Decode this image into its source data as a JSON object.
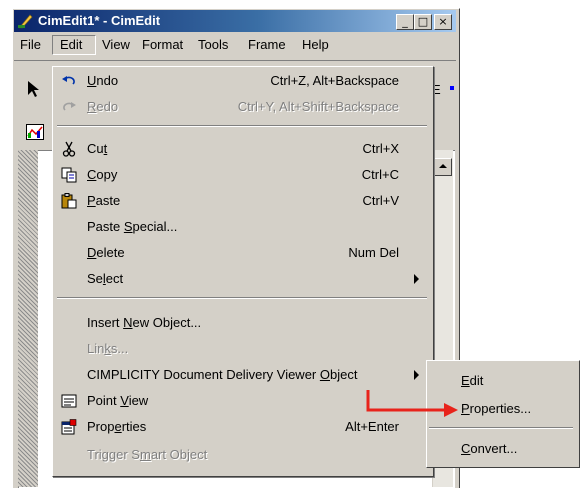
{
  "window": {
    "title": "CimEdit1* - CimEdit",
    "min_label": "_",
    "max_label": "□",
    "close_label": "×"
  },
  "menubar": {
    "items": [
      "File",
      "Edit",
      "View",
      "Format",
      "Tools",
      "Frame",
      "Help"
    ]
  },
  "background": {
    "hint_e": "E"
  },
  "edit_menu": {
    "items": [
      {
        "pre": "",
        "u": "U",
        "post": "ndo",
        "shortcut": "Ctrl+Z, Alt+Backspace",
        "icon": "undo-icon"
      },
      {
        "pre": "",
        "u": "R",
        "post": "edo",
        "shortcut": "Ctrl+Y, Alt+Shift+Backspace",
        "icon": "redo-icon"
      },
      {
        "pre": "Cu",
        "u": "t",
        "post": "",
        "shortcut": "Ctrl+X",
        "icon": "scissors-icon"
      },
      {
        "pre": "",
        "u": "C",
        "post": "opy",
        "shortcut": "Ctrl+C",
        "icon": "copy-icon"
      },
      {
        "pre": "",
        "u": "P",
        "post": "aste",
        "shortcut": "Ctrl+V",
        "icon": "paste-icon"
      },
      {
        "pre": "Paste ",
        "u": "S",
        "post": "pecial...",
        "shortcut": ""
      },
      {
        "pre": "",
        "u": "D",
        "post": "elete",
        "shortcut": "Num Del"
      },
      {
        "pre": "Se",
        "u": "l",
        "post": "ect",
        "shortcut": ""
      },
      {
        "pre": "Insert ",
        "u": "N",
        "post": "ew Object...",
        "shortcut": ""
      },
      {
        "pre": "Lin",
        "u": "k",
        "post": "s...",
        "shortcut": ""
      },
      {
        "pre": "CIMPLICITY Document Delivery Viewer ",
        "u": "O",
        "post": "bject",
        "shortcut": ""
      },
      {
        "pre": "Point ",
        "u": "V",
        "post": "iew",
        "shortcut": "",
        "icon": "point-view-icon"
      },
      {
        "pre": "Prop",
        "u": "e",
        "post": "rties",
        "shortcut": "Alt+Enter",
        "icon": "properties-icon"
      },
      {
        "pre": "Trigger S",
        "u": "m",
        "post": "art Object",
        "shortcut": ""
      }
    ]
  },
  "sub_menu": {
    "items": [
      {
        "pre": "",
        "u": "E",
        "post": "dit"
      },
      {
        "pre": "",
        "u": "P",
        "post": "roperties..."
      },
      {
        "pre": "",
        "u": "C",
        "post": "onvert..."
      }
    ]
  },
  "colors": {
    "title_start": "#0a246a",
    "title_end": "#a6caf0",
    "arrow": "#e8231b",
    "face": "#d4d0c8"
  }
}
